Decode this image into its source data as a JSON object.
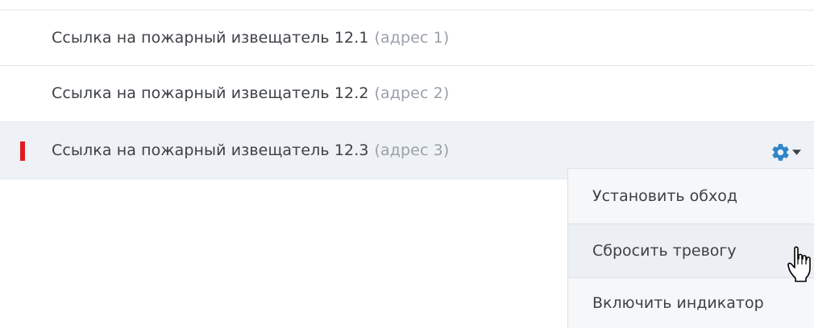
{
  "rows": [
    {
      "name": "Ссылка на пожарный извещатель 12.1",
      "address": "(адрес 1)",
      "alarm": false
    },
    {
      "name": "Ссылка на пожарный извещатель 12.2",
      "address": "(адрес 2)",
      "alarm": false
    },
    {
      "name": "Ссылка на пожарный извещатель 12.3",
      "address": "(адрес 3)",
      "alarm": true
    }
  ],
  "actions_menu": {
    "icon": "gear-icon",
    "caret_icon": "chevron-down-icon",
    "items": [
      {
        "label": "Установить обход"
      },
      {
        "label": "Сбросить тревогу",
        "hovered": true
      },
      {
        "label": "Включить индикатор"
      }
    ]
  },
  "colors": {
    "alarm": "#e01b24",
    "accent_icon": "#2f86c8",
    "selected_row_bg": "#eef1f5",
    "secondary_text": "#9aa1a9"
  }
}
